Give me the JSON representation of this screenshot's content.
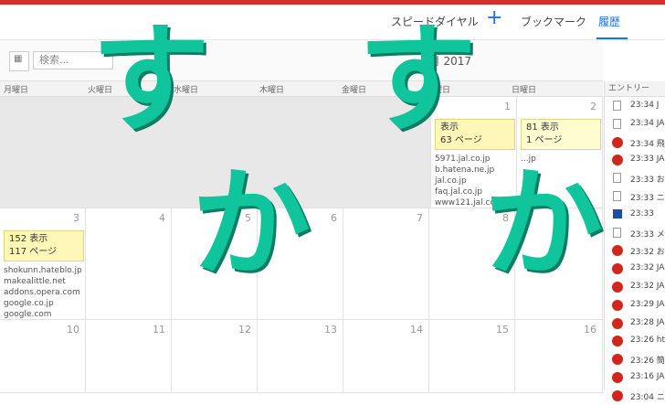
{
  "nav": {
    "speed_dial": "スピードダイヤル",
    "plus": "+",
    "bookmarks": "ブックマーク",
    "history": "履歴"
  },
  "toolbar": {
    "search_placeholder": "検索...",
    "month": "4月 2017"
  },
  "days": [
    "月曜日",
    "火曜日",
    "水曜日",
    "木曜日",
    "金曜日",
    "土曜日",
    "日曜日"
  ],
  "week1": {
    "sat": {
      "day": "1",
      "views": "表示",
      "pages": "63 ページ",
      "sites": [
        "5971.jal.co.jp",
        "b.hatena.ne.jp",
        "jal.co.jp",
        "faq.jal.co.jp",
        "www121.jal.co.jp"
      ]
    },
    "sun": {
      "day": "2",
      "views": "81 表示",
      "pages": "1 ページ",
      "sites": [
        "...jp"
      ]
    }
  },
  "week2": {
    "mon": {
      "day": "3",
      "views": "152 表示",
      "pages": "117 ページ",
      "sites": [
        "shokunn.hateblo.jp",
        "makealittle.net",
        "addons.opera.com",
        "google.co.jp",
        "google.com"
      ]
    },
    "days": [
      "4",
      "5",
      "6",
      "7",
      "8",
      "9"
    ]
  },
  "week3": {
    "days": [
      "10",
      "11",
      "12",
      "13",
      "14",
      "15",
      "16"
    ]
  },
  "entries": {
    "header": "エントリー",
    "items": [
      {
        "time": "23:34",
        "text": "J",
        "icon": "doc"
      },
      {
        "time": "23:34",
        "text": "JA",
        "icon": "doc"
      },
      {
        "time": "23:34",
        "text": "飛",
        "icon": "red"
      },
      {
        "time": "23:33",
        "text": "JA",
        "icon": "red"
      },
      {
        "time": "23:33",
        "text": "お",
        "icon": "doc"
      },
      {
        "time": "23:33",
        "text": "ニ",
        "icon": "doc"
      },
      {
        "time": "23:33",
        "text": "",
        "icon": "blue"
      },
      {
        "time": "23:33",
        "text": "メ",
        "icon": "doc"
      },
      {
        "time": "23:32",
        "text": "お",
        "icon": "red"
      },
      {
        "time": "23:32",
        "text": "JA",
        "icon": "red"
      },
      {
        "time": "23:32",
        "text": "JA",
        "icon": "red"
      },
      {
        "time": "23:29",
        "text": "JA",
        "icon": "red"
      },
      {
        "time": "23:28",
        "text": "JA",
        "icon": "red"
      },
      {
        "time": "23:26",
        "text": "ht",
        "icon": "red"
      },
      {
        "time": "23:26",
        "text": "簡",
        "icon": "red"
      },
      {
        "time": "23:16",
        "text": "JA",
        "icon": "red"
      },
      {
        "time": "23:04",
        "text": "ニ",
        "icon": "red"
      }
    ]
  },
  "overlay": {
    "su1": "す",
    "su2": "す",
    "ka1": "か",
    "ka2": "か"
  }
}
